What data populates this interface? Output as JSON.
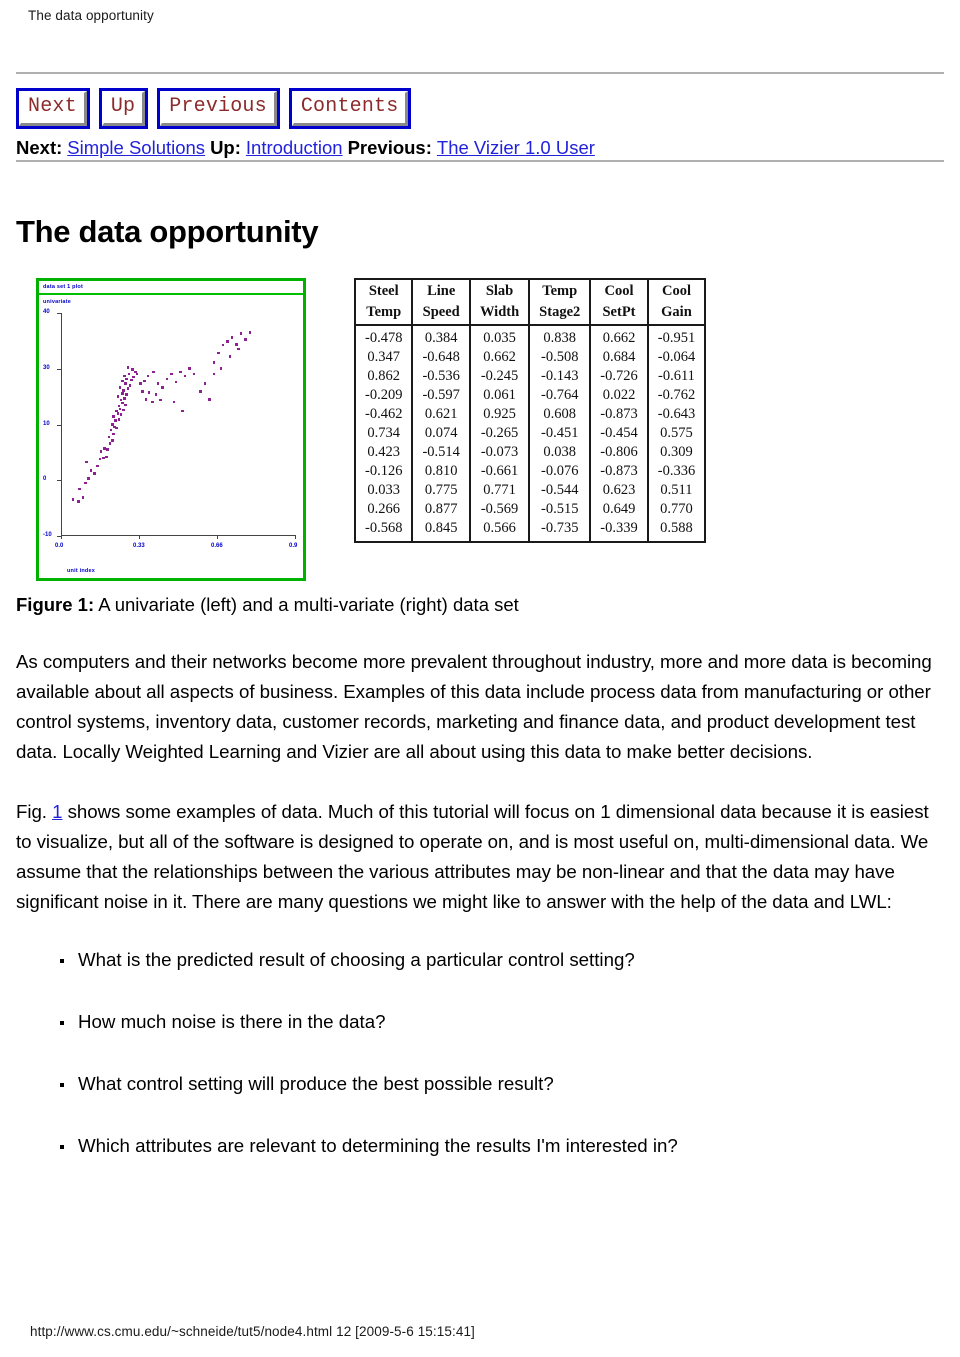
{
  "browser": {
    "header_title": "The data opportunity",
    "footer_status": "http://www.cs.cmu.edu/~schneide/tut5/node4.html 12 [2009-5-6 15:15:41]"
  },
  "nav": {
    "buttons": [
      {
        "label": "Next"
      },
      {
        "label": "Up"
      },
      {
        "label": "Previous"
      },
      {
        "label": "Contents"
      }
    ],
    "links": {
      "next_label": "Next:",
      "next_target": "Simple Solutions",
      "up_label": "Up:",
      "up_target": "Introduction",
      "previous_label": "Previous:",
      "previous_target": "The Vizier 1.0 User "
    }
  },
  "page": {
    "title": "The data opportunity"
  },
  "figure": {
    "caption_prefix": "Figure 1:",
    "caption_text": "A univariate (left) and a multi-variate (right) data set"
  },
  "chart_data": {
    "type": "scatter",
    "title": "data set 1 plot",
    "subtitle": "univariate",
    "xlabel": "unit index",
    "ylabel": "",
    "xtick_labels": [
      "0.0",
      "0.33",
      "0.66",
      "0.9"
    ],
    "ytick_labels": [
      "40",
      "30",
      "10",
      "0",
      "-10"
    ],
    "grid": false,
    "legend_position": "none",
    "point_color": "#8e2191",
    "border_color": "#00b200",
    "axis_label_color": "#0000cc",
    "points": [
      [
        0.03,
        0.04
      ],
      [
        0.055,
        0.03
      ],
      [
        0.075,
        0.05
      ],
      [
        0.06,
        0.095
      ],
      [
        0.085,
        0.125
      ],
      [
        0.1,
        0.15
      ],
      [
        0.11,
        0.19
      ],
      [
        0.125,
        0.175
      ],
      [
        0.14,
        0.215
      ],
      [
        0.09,
        0.235
      ],
      [
        0.15,
        0.25
      ],
      [
        0.165,
        0.255
      ],
      [
        0.18,
        0.26
      ],
      [
        0.155,
        0.29
      ],
      [
        0.17,
        0.305
      ],
      [
        0.185,
        0.3
      ],
      [
        0.195,
        0.33
      ],
      [
        0.205,
        0.345
      ],
      [
        0.19,
        0.365
      ],
      [
        0.21,
        0.38
      ],
      [
        0.2,
        0.4
      ],
      [
        0.215,
        0.415
      ],
      [
        0.225,
        0.41
      ],
      [
        0.205,
        0.43
      ],
      [
        0.22,
        0.45
      ],
      [
        0.235,
        0.455
      ],
      [
        0.21,
        0.47
      ],
      [
        0.23,
        0.485
      ],
      [
        0.245,
        0.48
      ],
      [
        0.225,
        0.5
      ],
      [
        0.24,
        0.51
      ],
      [
        0.255,
        0.505
      ],
      [
        0.235,
        0.525
      ],
      [
        0.25,
        0.54
      ],
      [
        0.265,
        0.53
      ],
      [
        0.245,
        0.555
      ],
      [
        0.26,
        0.565
      ],
      [
        0.23,
        0.575
      ],
      [
        0.25,
        0.59
      ],
      [
        0.27,
        0.585
      ],
      [
        0.255,
        0.605
      ],
      [
        0.275,
        0.615
      ],
      [
        0.24,
        0.62
      ],
      [
        0.265,
        0.64
      ],
      [
        0.285,
        0.63
      ],
      [
        0.25,
        0.655
      ],
      [
        0.27,
        0.665
      ],
      [
        0.29,
        0.66
      ],
      [
        0.26,
        0.68
      ],
      [
        0.28,
        0.69
      ],
      [
        0.3,
        0.675
      ],
      [
        0.31,
        0.7
      ],
      [
        0.295,
        0.715
      ],
      [
        0.275,
        0.725
      ],
      [
        0.315,
        0.69
      ],
      [
        0.33,
        0.64
      ],
      [
        0.34,
        0.6
      ],
      [
        0.355,
        0.56
      ],
      [
        0.37,
        0.595
      ],
      [
        0.385,
        0.545
      ],
      [
        0.4,
        0.585
      ],
      [
        0.42,
        0.555
      ],
      [
        0.35,
        0.655
      ],
      [
        0.365,
        0.68
      ],
      [
        0.39,
        0.7
      ],
      [
        0.41,
        0.64
      ],
      [
        0.43,
        0.62
      ],
      [
        0.45,
        0.665
      ],
      [
        0.47,
        0.69
      ],
      [
        0.49,
        0.65
      ],
      [
        0.51,
        0.7
      ],
      [
        0.53,
        0.68
      ],
      [
        0.55,
        0.72
      ],
      [
        0.57,
        0.69
      ],
      [
        0.48,
        0.545
      ],
      [
        0.52,
        0.5
      ],
      [
        0.6,
        0.6
      ],
      [
        0.62,
        0.64
      ],
      [
        0.64,
        0.56
      ],
      [
        0.66,
        0.75
      ],
      [
        0.68,
        0.8
      ],
      [
        0.7,
        0.84
      ],
      [
        0.72,
        0.86
      ],
      [
        0.74,
        0.88
      ],
      [
        0.76,
        0.845
      ],
      [
        0.78,
        0.9
      ],
      [
        0.8,
        0.87
      ],
      [
        0.82,
        0.905
      ],
      [
        0.66,
        0.69
      ],
      [
        0.69,
        0.72
      ],
      [
        0.73,
        0.78
      ],
      [
        0.77,
        0.82
      ]
    ]
  },
  "table": {
    "headers_line1": [
      "Steel",
      "Line",
      "Slab",
      "Temp",
      "Cool",
      "Cool"
    ],
    "headers_line2": [
      "Temp",
      "Speed",
      "Width",
      "Stage2",
      "SetPt",
      "Gain"
    ],
    "rows": [
      [
        "-0.478",
        "0.384",
        "0.035",
        "0.838",
        "0.662",
        "-0.951"
      ],
      [
        "0.347",
        "-0.648",
        "0.662",
        "-0.508",
        "0.684",
        "-0.064"
      ],
      [
        "0.862",
        "-0.536",
        "-0.245",
        "-0.143",
        "-0.726",
        "-0.611"
      ],
      [
        "-0.209",
        "-0.597",
        "0.061",
        "-0.764",
        "0.022",
        "-0.762"
      ],
      [
        "-0.462",
        "0.621",
        "0.925",
        "0.608",
        "-0.873",
        "-0.643"
      ],
      [
        "0.734",
        "0.074",
        "-0.265",
        "-0.451",
        "-0.454",
        "0.575"
      ],
      [
        "0.423",
        "-0.514",
        "-0.073",
        "0.038",
        "-0.806",
        "0.309"
      ],
      [
        "-0.126",
        "0.810",
        "-0.661",
        "-0.076",
        "-0.873",
        "-0.336"
      ],
      [
        "0.033",
        "0.775",
        "0.771",
        "-0.544",
        "0.623",
        "0.511"
      ],
      [
        "0.266",
        "0.877",
        "-0.569",
        "-0.515",
        "0.649",
        "0.770"
      ],
      [
        "-0.568",
        "0.845",
        "0.566",
        "-0.735",
        "-0.339",
        "0.588"
      ]
    ]
  },
  "content": {
    "paragraph1": "As computers and their networks become more prevalent throughout industry, more and more data is becoming available about all aspects of business. Examples of this data include process data from manufacturing or other control systems, inventory data, customer records, marketing and finance data, and product development test data. Locally Weighted Learning and Vizier are all about using this data to make better decisions.",
    "paragraph2_pre": "Fig. ",
    "paragraph2_link": "1",
    "paragraph2_post": " shows some examples of data. Much of this tutorial will focus on 1 dimensional data because it is easiest to visualize, but all of the software is designed to operate on, and is most useful on, multi-dimensional data. We assume that the relationships between the various attributes may be non-linear and that the data may have significant noise in it. There are many questions we might like to answer with the help of the data and LWL:",
    "questions": [
      "What is the predicted result of choosing a particular control setting?",
      "How much noise is there in the data?",
      "What control setting will produce the best possible result?",
      "Which attributes are relevant to determining the results I'm interested in?"
    ]
  }
}
